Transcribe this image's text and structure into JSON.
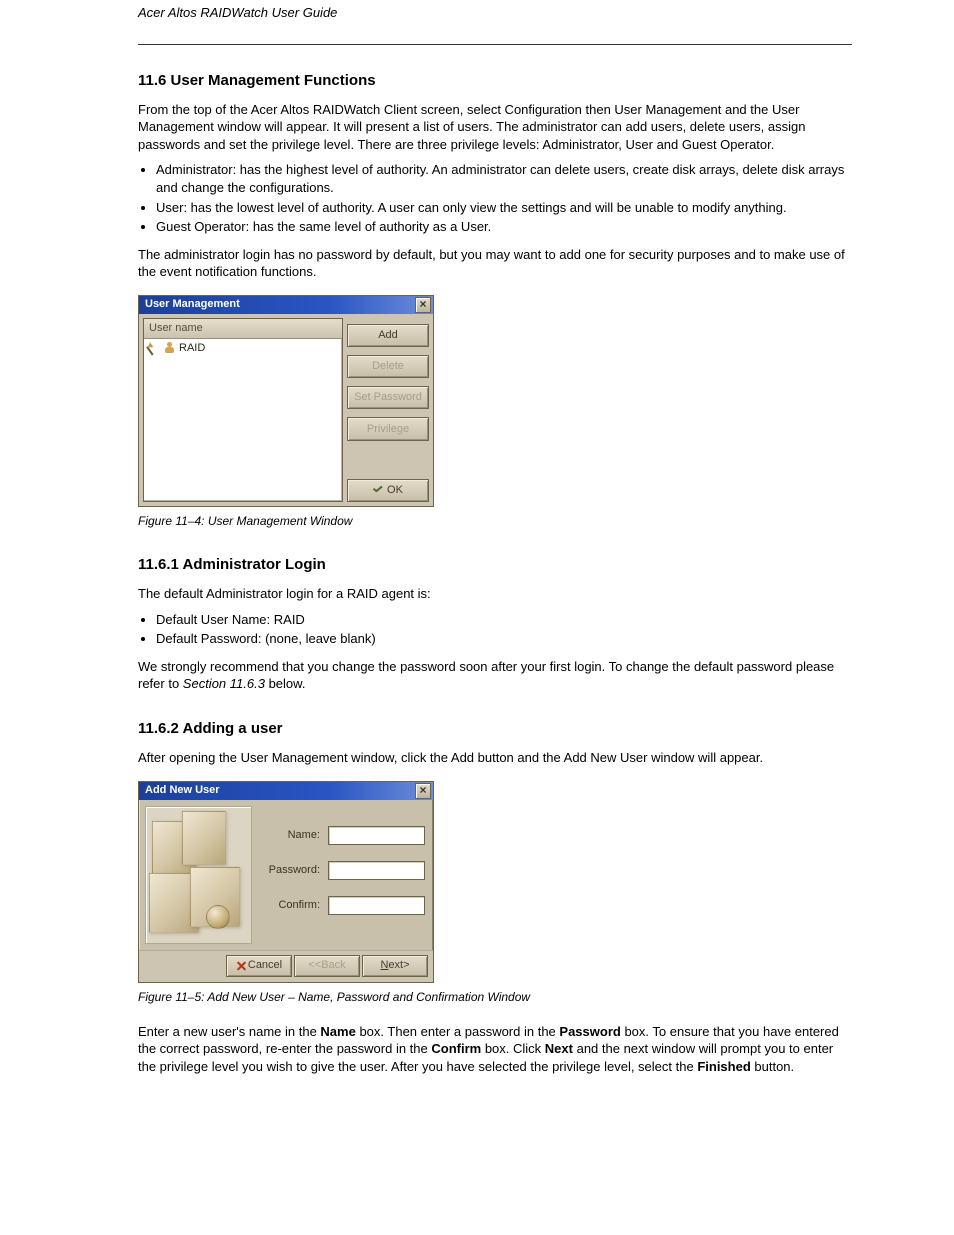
{
  "header": "Acer Altos RAIDWatch User Guide",
  "sections": {
    "s1": {
      "title": "11.6  User Management Functions",
      "p1": "From the top of the Acer Altos RAIDWatch Client screen, select Configuration then User Management and the User Management window will appear. It will present a list of users. The administrator can add users, delete users, assign passwords and set the privilege level. There are three privilege levels: Administrator, User and Guest Operator.",
      "bullets": [
        "Administrator: has the highest level of authority. An administrator can delete users, create disk arrays, delete disk arrays and change the configurations.",
        "User: has the lowest level of authority. A user can only view the settings and will be unable to modify anything.",
        "Guest Operator: has the same level of authority as a User."
      ],
      "p2": "The administrator login has no password by default, but you may want to add one for security purposes and to make use of the event notification functions.",
      "caption": "Figure 11–4:  User Management Window"
    },
    "s2": {
      "title": "11.6.1   Administrator Login",
      "p1": "The default Administrator login for a RAID agent is:",
      "bullets": [
        "Default User Name:   RAID",
        "Default Password:   (none, leave blank)"
      ],
      "p2_a": "We strongly recommend that you change the password soon after your first login. To change the default password please refer to ",
      "p2_link": "Section 11.6.3",
      "p2_b": " below."
    },
    "s3": {
      "title": "11.6.2   Adding a user",
      "p1": "After opening the User Management window, click the Add button and the Add New User window will appear.",
      "caption": "Figure 11–5:  Add New User – Name, Password and Confirmation Window",
      "p2_a": "Enter a new user's name in the ",
      "p2_b": " box. Then enter a password in the ",
      "p2_c": " box. To ensure that you have entered the correct password, re-enter the password in the ",
      "p2_d": " box. Click ",
      "p2_e": " and the next window will prompt you to enter the privilege level you wish to give the user. After you have selected the privilege level, select the ",
      "p2_f": " button.",
      "lbl_name": "Name",
      "lbl_password": "Password",
      "lbl_confirm": "Confirm",
      "lbl_next": "Next",
      "lbl_finished": "Finished"
    }
  },
  "um_dialog": {
    "title": "User Management",
    "col": "User name",
    "row": "RAID",
    "btn_add": "Add",
    "btn_delete": "Delete",
    "btn_setpw": "Set Password",
    "btn_priv": "Privilege",
    "btn_ok": "OK"
  },
  "anu_dialog": {
    "title": "Add New User",
    "lbl_name": "Name:",
    "lbl_pw": "Password:",
    "lbl_cf": "Confirm:",
    "btn_cancel": "Cancel",
    "btn_back": "<<Back",
    "btn_next": "Next>",
    "next_ul_first": "N",
    "next_rest": "ext>"
  }
}
